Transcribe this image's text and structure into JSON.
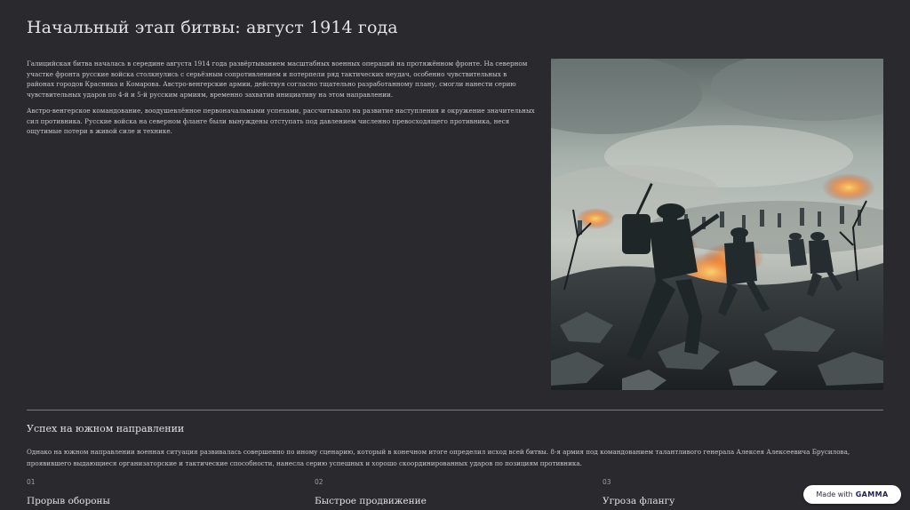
{
  "page": {
    "title": "Начальный этап битвы: август 1914 года"
  },
  "intro": {
    "paragraphs": [
      "Галицийская битва началась в середине августа 1914 года развёртыванием масштабных военных операций на протяжённом фронте. На северном участке фронта русские войска столкнулись с серьёзным сопротивлением и потерпели ряд тактических неудач, особенно чувствительных в районах городов Красника и Комарова. Австро-венгерские армии, действуя согласно тщательно разработанному плану, смогли нанести серию чувствительных ударов по 4-й и 5-й русским армиям, временно захватив инициативу на этом направлении.",
      "Австро-венгерское командование, воодушевлённое первоначальными успехами, рассчитывало на развитие наступления и окружение значительных сил противника. Русские войска на северном фланге были вынуждены отступать под давлением численно превосходящего противника, неся ощутимые потери в живой силе и технике."
    ]
  },
  "section": {
    "title": "Успех на южном направлении",
    "body": "Однако на южном направлении военная ситуация развивалась совершенно по иному сценарию, который в конечном итоге определил исход всей битвы. 8-я армия под командованием талантливого генерала Алексея Алексеевича Брусилова, проявившего выдающиеся организаторские и тактические способности, нанесла серию успешных и хорошо скоординированных ударов по позициям противника."
  },
  "cards": [
    {
      "num": "01",
      "title": "Прорыв обороны"
    },
    {
      "num": "02",
      "title": "Быстрое продвижение"
    },
    {
      "num": "03",
      "title": "Угроза флангу"
    }
  ],
  "badge": {
    "prefix": "Made with",
    "brand": "GAMMA"
  },
  "colors": {
    "background": "#2a2a2e",
    "divider": "#7a7a80",
    "fire": "#ff8a2a"
  }
}
